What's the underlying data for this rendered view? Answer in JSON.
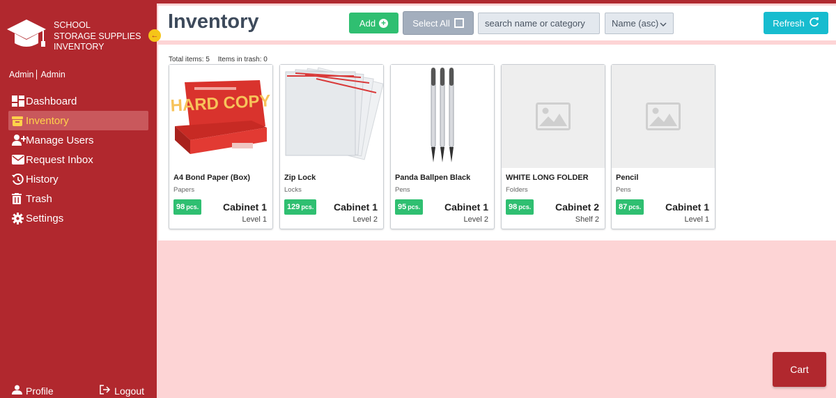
{
  "app": {
    "brand_line1": "SCHOOL",
    "brand_line2": "STORAGE SUPPLIES",
    "brand_line3": "INVENTORY",
    "user_role": "Admin",
    "user_name": "Admin"
  },
  "sidebar": {
    "items": [
      {
        "label": "Dashboard",
        "icon": "dashboard-icon"
      },
      {
        "label": "Inventory",
        "icon": "box-icon",
        "active": true
      },
      {
        "label": "Manage Users",
        "icon": "add-user-icon"
      },
      {
        "label": "Request Inbox",
        "icon": "envelope-icon"
      },
      {
        "label": "History",
        "icon": "history-icon"
      },
      {
        "label": "Trash",
        "icon": "trash-icon"
      },
      {
        "label": "Settings",
        "icon": "gear-icon"
      }
    ],
    "profile_label": "Profile",
    "logout_label": "Logout"
  },
  "header": {
    "title": "Inventory",
    "add_label": "Add",
    "select_all_label": "Select All",
    "search_placeholder": "search name or category",
    "sort_value": "Name (asc)",
    "refresh_label": "Refresh"
  },
  "summary": {
    "total_items": "Total items: 5",
    "items_in_trash": "Items in trash: 0"
  },
  "items": [
    {
      "name": "A4 Bond Paper (Box)",
      "category": "Papers",
      "qty": "98",
      "unit": "pcs.",
      "cabinet": "Cabinet 1",
      "level": "Level 1",
      "image": "paper-box"
    },
    {
      "name": "Zip Lock",
      "category": "Locks",
      "qty": "129",
      "unit": "pcs.",
      "cabinet": "Cabinet 1",
      "level": "Level 2",
      "image": "ziplock-bags"
    },
    {
      "name": "Panda Ballpen Black",
      "category": "Pens",
      "qty": "95",
      "unit": "pcs.",
      "cabinet": "Cabinet 1",
      "level": "Level 2",
      "image": "ballpens"
    },
    {
      "name": "WHITE LONG FOLDER",
      "category": "Folders",
      "qty": "98",
      "unit": "pcs.",
      "cabinet": "Cabinet 2",
      "level": "Shelf 2",
      "image": "placeholder"
    },
    {
      "name": "Pencil",
      "category": "Pens",
      "qty": "87",
      "unit": "pcs.",
      "cabinet": "Cabinet 1",
      "level": "Level 1",
      "image": "placeholder"
    }
  ],
  "product_art": {
    "paper_box_brand": "HARD COPY"
  },
  "cart": {
    "label": "Cart"
  },
  "colors": {
    "sidebar": "#b1282e",
    "background": "#fdd4d5",
    "accent_yellow": "#ffd24a",
    "green": "#2fbf71",
    "teal": "#17bccf"
  }
}
